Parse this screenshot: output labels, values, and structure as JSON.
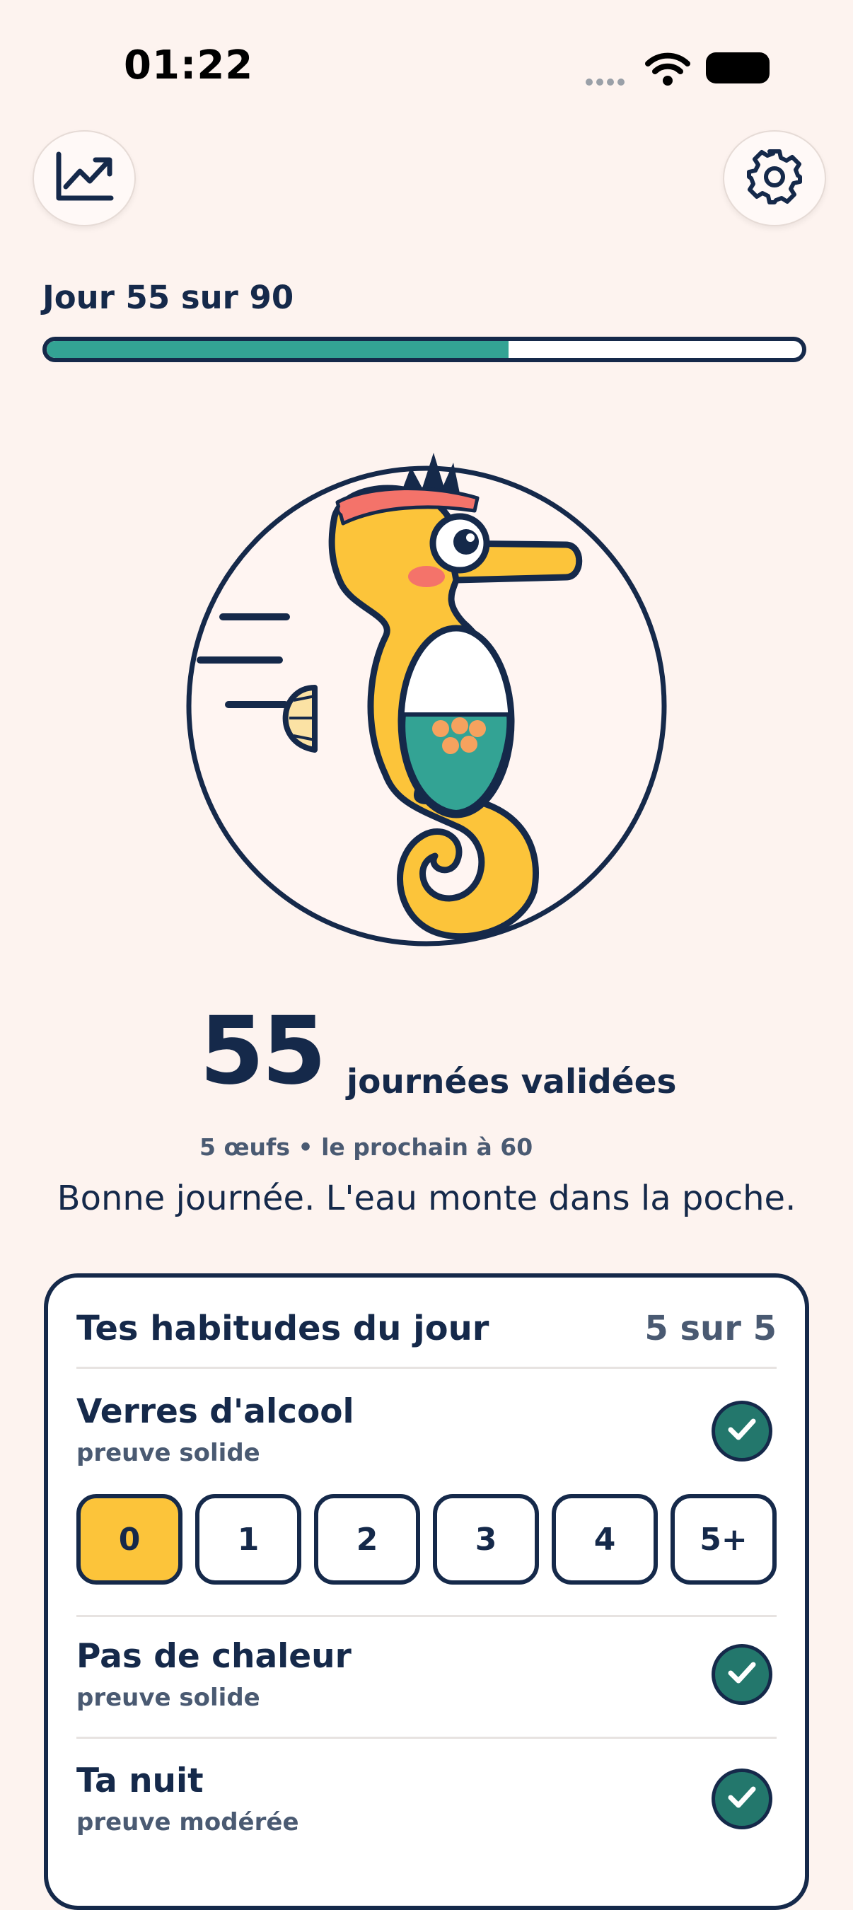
{
  "status_bar": {
    "time": "01:22"
  },
  "header": {
    "stats_icon": "chart-trend-icon",
    "settings_icon": "gear-icon"
  },
  "progress": {
    "label": "Jour 55 sur 90",
    "current": 55,
    "total": 90
  },
  "mascot": {
    "icon": "seahorse-illustration"
  },
  "counter": {
    "value": "55",
    "label": "journées validées",
    "eggs": "5 œufs • le prochain à 60"
  },
  "message": "Bonne journée. L'eau monte dans la poche.",
  "habits_card": {
    "title": "Tes habitudes du jour",
    "count": "5 sur 5",
    "habits": [
      {
        "name": "Verres d'alcool",
        "proof": "preuve solide",
        "checked": true,
        "options": [
          "0",
          "1",
          "2",
          "3",
          "4",
          "5+"
        ],
        "selected": "0"
      },
      {
        "name": "Pas de chaleur",
        "proof": "preuve solide",
        "checked": true
      },
      {
        "name": "Ta nuit",
        "proof": "preuve modérée",
        "checked": true
      }
    ]
  },
  "colors": {
    "background": "#FDF3EF",
    "ink": "#15294A",
    "teal": "#33A394",
    "dark_teal": "#23776C",
    "yellow": "#FCC43A",
    "coral": "#F4736A"
  }
}
